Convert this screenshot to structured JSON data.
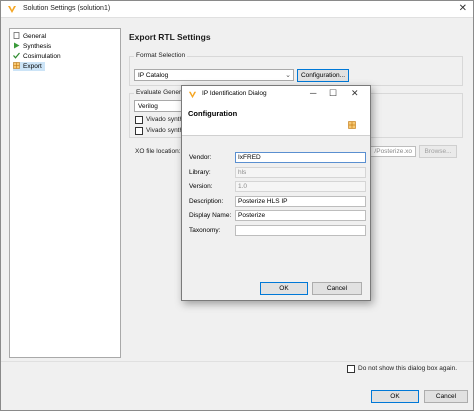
{
  "window": {
    "title": "Solution Settings (solution1)"
  },
  "sidebar": {
    "items": [
      {
        "label": "General",
        "icon": "document-icon"
      },
      {
        "label": "Synthesis",
        "icon": "play-arrow-icon"
      },
      {
        "label": "Cosimulation",
        "icon": "check-icon"
      },
      {
        "label": "Export",
        "icon": "grid-icon"
      }
    ]
  },
  "export": {
    "heading": "Export RTL Settings",
    "format_label": "Format Selection",
    "format_value": "IP Catalog",
    "configuration_button": "Configuration...",
    "evaluate_label": "Evaluate Generated",
    "language_value": "Verilog",
    "vivado_synth_1": "Vivado synthesis",
    "vivado_synth_2": "Vivado synthesis",
    "xo_label": "XO file location:",
    "xo_path": "/Posterize.xo",
    "browse_button": "Browse..."
  },
  "dialog": {
    "title": "IP Identification Dialog",
    "section_title": "Configuration",
    "fields": {
      "vendor": {
        "label": "Vendor:",
        "value": "IxFRED"
      },
      "library": {
        "label": "Library:",
        "value": "hls"
      },
      "version": {
        "label": "Version:",
        "value": "1.0"
      },
      "description": {
        "label": "Description:",
        "value": "Posterize HLS IP"
      },
      "display_name": {
        "label": "Display Name:",
        "value": "Posterize"
      },
      "taxonomy": {
        "label": "Taxonomy:",
        "value": ""
      }
    },
    "ok_button": "OK",
    "cancel_button": "Cancel"
  },
  "footer": {
    "dont_show_label": "Do not show this dialog box again.",
    "ok_button": "OK",
    "cancel_button": "Cancel"
  },
  "colors": {
    "accent": "#0078d7",
    "selection": "#cce4f7",
    "app_logo": "#f5a623"
  }
}
